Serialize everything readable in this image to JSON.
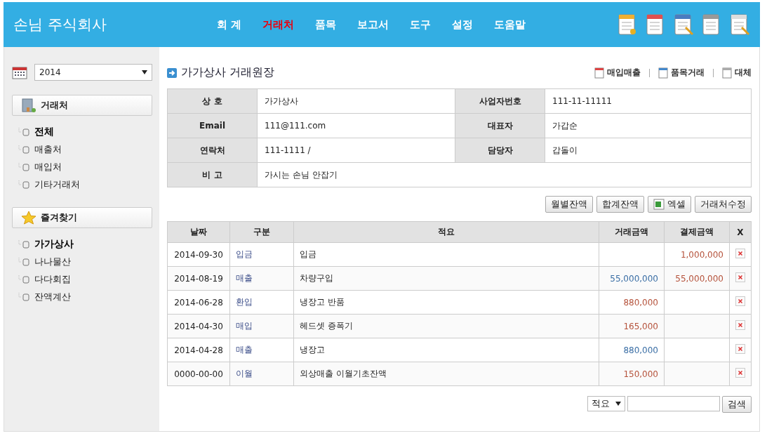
{
  "header": {
    "title": "손님 주식회사",
    "nav": [
      {
        "label": "회 계",
        "selected": false
      },
      {
        "label": "거래처",
        "selected": true
      },
      {
        "label": "품목",
        "selected": false
      },
      {
        "label": "보고서",
        "selected": false
      },
      {
        "label": "도구",
        "selected": false
      },
      {
        "label": "설정",
        "selected": false
      },
      {
        "label": "도움말",
        "selected": false
      }
    ]
  },
  "sidebar": {
    "year": "2014",
    "sections": [
      {
        "title": "거래처",
        "kind": "building",
        "items": [
          {
            "label": "전체",
            "selected": true
          },
          {
            "label": "매출처",
            "selected": false
          },
          {
            "label": "매입처",
            "selected": false
          },
          {
            "label": "기타거래처",
            "selected": false
          }
        ]
      },
      {
        "title": "즐겨찾기",
        "kind": "star",
        "items": [
          {
            "label": "가가상사",
            "selected": true
          },
          {
            "label": "나나물산",
            "selected": false
          },
          {
            "label": "다다회집",
            "selected": false
          },
          {
            "label": "잔액계산",
            "selected": false
          }
        ]
      }
    ]
  },
  "page_title": "가가상사 거래원장",
  "top_links": [
    "매입매출",
    "품목거래",
    "대체"
  ],
  "info": [
    {
      "label": "상 호",
      "value": "가가상사",
      "label2": "사업자번호",
      "value2": "111-11-11111"
    },
    {
      "label": "Email",
      "value": "111@111.com",
      "label2": "대표자",
      "value2": "가갑순"
    },
    {
      "label": "연락처",
      "value": "111-1111 /",
      "label2": "담당자",
      "value2": "갑돌이"
    },
    {
      "label": "비 고",
      "value": "가시는 손님 안잡기"
    }
  ],
  "actions": [
    {
      "label": "월별잔액",
      "kind": "plain"
    },
    {
      "label": "합계잔액",
      "kind": "plain"
    },
    {
      "label": "엑셀",
      "kind": "excel"
    },
    {
      "label": "거래처수정",
      "kind": "plain"
    }
  ],
  "table": {
    "columns": [
      "날짜",
      "구분",
      "적요",
      "거래금액",
      "결제금액",
      "X"
    ],
    "rows": [
      {
        "date": "2014-09-30",
        "type": "입금",
        "memo": "입금",
        "amount": null,
        "payment": {
          "text": "1,000,000",
          "color": "#b5523b"
        }
      },
      {
        "date": "2014-08-19",
        "type": "매출",
        "memo": "차량구입",
        "amount": {
          "text": "55,000,000",
          "color": "#3a6ea5"
        },
        "payment": {
          "text": "55,000,000",
          "color": "#b5523b"
        }
      },
      {
        "date": "2014-06-28",
        "type": "환입",
        "memo": "냉장고 반품",
        "amount": {
          "text": "880,000",
          "color": "#b5523b"
        },
        "payment": null
      },
      {
        "date": "2014-04-30",
        "type": "매입",
        "memo": "헤드셋 증폭기",
        "amount": {
          "text": "165,000",
          "color": "#b5523b"
        },
        "payment": null
      },
      {
        "date": "2014-04-28",
        "type": "매출",
        "memo": "냉장고",
        "amount": {
          "text": "880,000",
          "color": "#3a6ea5"
        },
        "payment": null
      },
      {
        "date": "0000-00-00",
        "type": "이월",
        "memo": "외상매출 이월기초잔액",
        "amount": {
          "text": "150,000",
          "color": "#b5523b"
        },
        "payment": null
      }
    ]
  },
  "search": {
    "field": "적요",
    "button": "검색"
  }
}
